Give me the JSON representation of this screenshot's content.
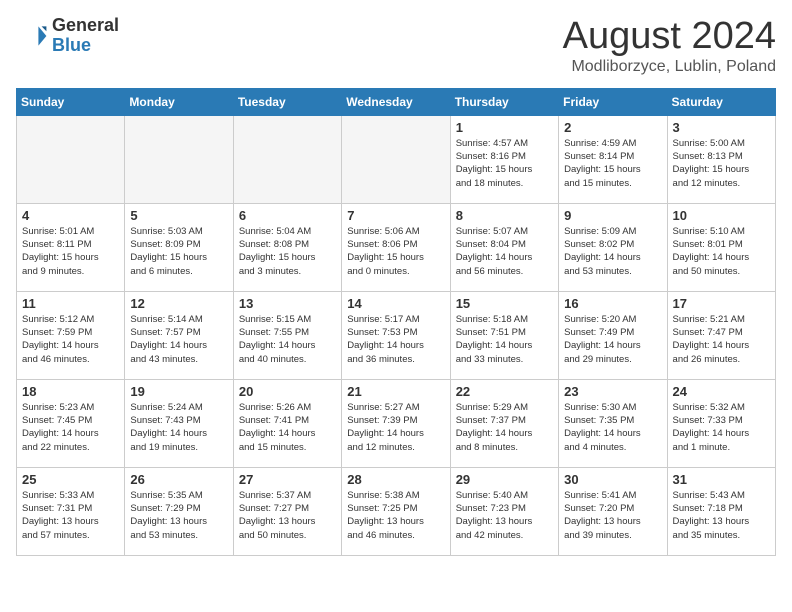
{
  "header": {
    "logo_general": "General",
    "logo_blue": "Blue",
    "month_title": "August 2024",
    "location": "Modliborzyce, Lublin, Poland"
  },
  "days_of_week": [
    "Sunday",
    "Monday",
    "Tuesday",
    "Wednesday",
    "Thursday",
    "Friday",
    "Saturday"
  ],
  "weeks": [
    [
      {
        "day": "",
        "info": ""
      },
      {
        "day": "",
        "info": ""
      },
      {
        "day": "",
        "info": ""
      },
      {
        "day": "",
        "info": ""
      },
      {
        "day": "1",
        "info": "Sunrise: 4:57 AM\nSunset: 8:16 PM\nDaylight: 15 hours\nand 18 minutes."
      },
      {
        "day": "2",
        "info": "Sunrise: 4:59 AM\nSunset: 8:14 PM\nDaylight: 15 hours\nand 15 minutes."
      },
      {
        "day": "3",
        "info": "Sunrise: 5:00 AM\nSunset: 8:13 PM\nDaylight: 15 hours\nand 12 minutes."
      }
    ],
    [
      {
        "day": "4",
        "info": "Sunrise: 5:01 AM\nSunset: 8:11 PM\nDaylight: 15 hours\nand 9 minutes."
      },
      {
        "day": "5",
        "info": "Sunrise: 5:03 AM\nSunset: 8:09 PM\nDaylight: 15 hours\nand 6 minutes."
      },
      {
        "day": "6",
        "info": "Sunrise: 5:04 AM\nSunset: 8:08 PM\nDaylight: 15 hours\nand 3 minutes."
      },
      {
        "day": "7",
        "info": "Sunrise: 5:06 AM\nSunset: 8:06 PM\nDaylight: 15 hours\nand 0 minutes."
      },
      {
        "day": "8",
        "info": "Sunrise: 5:07 AM\nSunset: 8:04 PM\nDaylight: 14 hours\nand 56 minutes."
      },
      {
        "day": "9",
        "info": "Sunrise: 5:09 AM\nSunset: 8:02 PM\nDaylight: 14 hours\nand 53 minutes."
      },
      {
        "day": "10",
        "info": "Sunrise: 5:10 AM\nSunset: 8:01 PM\nDaylight: 14 hours\nand 50 minutes."
      }
    ],
    [
      {
        "day": "11",
        "info": "Sunrise: 5:12 AM\nSunset: 7:59 PM\nDaylight: 14 hours\nand 46 minutes."
      },
      {
        "day": "12",
        "info": "Sunrise: 5:14 AM\nSunset: 7:57 PM\nDaylight: 14 hours\nand 43 minutes."
      },
      {
        "day": "13",
        "info": "Sunrise: 5:15 AM\nSunset: 7:55 PM\nDaylight: 14 hours\nand 40 minutes."
      },
      {
        "day": "14",
        "info": "Sunrise: 5:17 AM\nSunset: 7:53 PM\nDaylight: 14 hours\nand 36 minutes."
      },
      {
        "day": "15",
        "info": "Sunrise: 5:18 AM\nSunset: 7:51 PM\nDaylight: 14 hours\nand 33 minutes."
      },
      {
        "day": "16",
        "info": "Sunrise: 5:20 AM\nSunset: 7:49 PM\nDaylight: 14 hours\nand 29 minutes."
      },
      {
        "day": "17",
        "info": "Sunrise: 5:21 AM\nSunset: 7:47 PM\nDaylight: 14 hours\nand 26 minutes."
      }
    ],
    [
      {
        "day": "18",
        "info": "Sunrise: 5:23 AM\nSunset: 7:45 PM\nDaylight: 14 hours\nand 22 minutes."
      },
      {
        "day": "19",
        "info": "Sunrise: 5:24 AM\nSunset: 7:43 PM\nDaylight: 14 hours\nand 19 minutes."
      },
      {
        "day": "20",
        "info": "Sunrise: 5:26 AM\nSunset: 7:41 PM\nDaylight: 14 hours\nand 15 minutes."
      },
      {
        "day": "21",
        "info": "Sunrise: 5:27 AM\nSunset: 7:39 PM\nDaylight: 14 hours\nand 12 minutes."
      },
      {
        "day": "22",
        "info": "Sunrise: 5:29 AM\nSunset: 7:37 PM\nDaylight: 14 hours\nand 8 minutes."
      },
      {
        "day": "23",
        "info": "Sunrise: 5:30 AM\nSunset: 7:35 PM\nDaylight: 14 hours\nand 4 minutes."
      },
      {
        "day": "24",
        "info": "Sunrise: 5:32 AM\nSunset: 7:33 PM\nDaylight: 14 hours\nand 1 minute."
      }
    ],
    [
      {
        "day": "25",
        "info": "Sunrise: 5:33 AM\nSunset: 7:31 PM\nDaylight: 13 hours\nand 57 minutes."
      },
      {
        "day": "26",
        "info": "Sunrise: 5:35 AM\nSunset: 7:29 PM\nDaylight: 13 hours\nand 53 minutes."
      },
      {
        "day": "27",
        "info": "Sunrise: 5:37 AM\nSunset: 7:27 PM\nDaylight: 13 hours\nand 50 minutes."
      },
      {
        "day": "28",
        "info": "Sunrise: 5:38 AM\nSunset: 7:25 PM\nDaylight: 13 hours\nand 46 minutes."
      },
      {
        "day": "29",
        "info": "Sunrise: 5:40 AM\nSunset: 7:23 PM\nDaylight: 13 hours\nand 42 minutes."
      },
      {
        "day": "30",
        "info": "Sunrise: 5:41 AM\nSunset: 7:20 PM\nDaylight: 13 hours\nand 39 minutes."
      },
      {
        "day": "31",
        "info": "Sunrise: 5:43 AM\nSunset: 7:18 PM\nDaylight: 13 hours\nand 35 minutes."
      }
    ]
  ]
}
